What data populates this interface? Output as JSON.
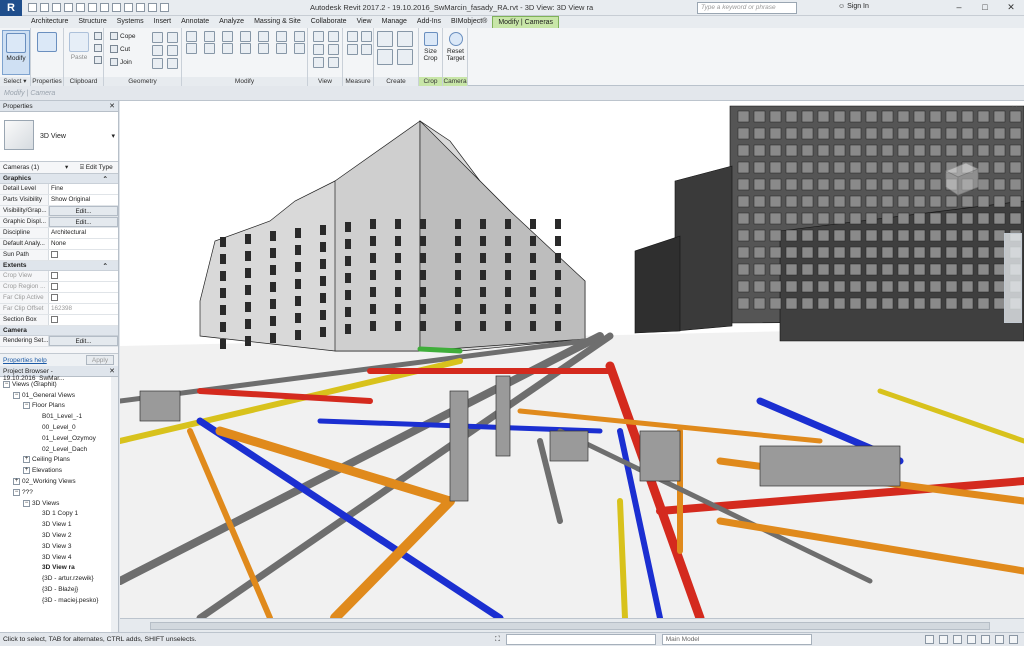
{
  "window": {
    "title": "Autodesk Revit 2017.2 -   19.10.2016_SwMarcin_fasady_RA.rvt - 3D View: 3D View ra",
    "search_placeholder": "Type a keyword or phrase",
    "signin_label": "Sign In",
    "minimize": "–",
    "maximize": "□",
    "close": "✕"
  },
  "ribbon": {
    "tabs": [
      "Architecture",
      "Structure",
      "Systems",
      "Insert",
      "Annotate",
      "Analyze",
      "Massing & Site",
      "Collaborate",
      "View",
      "Manage",
      "Add-Ins",
      "BIMobject®",
      "Modify | Cameras"
    ],
    "active_tab": "Modify | Cameras",
    "panels": {
      "select": {
        "title": "Select ▾",
        "button": "Modify"
      },
      "properties": {
        "title": "Properties"
      },
      "clipboard": {
        "title": "Clipboard",
        "paste": "Paste"
      },
      "geometry": {
        "title": "Geometry",
        "cope": "Cope",
        "cut": "Cut",
        "join": "Join"
      },
      "modify": {
        "title": "Modify"
      },
      "view": {
        "title": "View"
      },
      "measure": {
        "title": "Measure"
      },
      "create": {
        "title": "Create"
      },
      "crop": {
        "title": "Crop",
        "size_crop": "Size Crop"
      },
      "camera": {
        "title": "Camera",
        "reset_target": "Reset Target"
      }
    }
  },
  "options_bar": {
    "text": "Modify | Camera"
  },
  "properties": {
    "header": "Properties",
    "type_name": "3D View",
    "instance_selector": "Cameras (1)",
    "edit_type": "Edit Type",
    "groups": {
      "graphics": "Graphics",
      "extents": "Extents",
      "camera": "Camera"
    },
    "rows": [
      {
        "key": "Detail Level",
        "value": "Fine"
      },
      {
        "key": "Parts Visibility",
        "value": "Show Original"
      },
      {
        "key": "Visibility/Grap...",
        "value": "Edit..."
      },
      {
        "key": "Graphic Displ...",
        "value": "Edit..."
      },
      {
        "key": "Discipline",
        "value": "Architectural"
      },
      {
        "key": "Default Analy...",
        "value": "None"
      },
      {
        "key": "Sun Path",
        "value": ""
      }
    ],
    "extent_rows": [
      {
        "key": "Crop View",
        "value": ""
      },
      {
        "key": "Crop Region ...",
        "value": ""
      },
      {
        "key": "Far Clip Active",
        "value": ""
      },
      {
        "key": "Far Clip Offset",
        "value": "162398"
      },
      {
        "key": "Section Box",
        "value": ""
      }
    ],
    "camera_rows": [
      {
        "key": "Rendering Set...",
        "value": "Edit..."
      }
    ],
    "help_link": "Properties help",
    "apply": "Apply"
  },
  "browser": {
    "header": "Project Browser - 19.10.2016_SwMar...",
    "nodes": [
      {
        "label": "Views (Graphit)",
        "indent": 0,
        "ex": "−"
      },
      {
        "label": "01_General Views",
        "indent": 1,
        "ex": "−"
      },
      {
        "label": "Floor Plans",
        "indent": 2,
        "ex": "−"
      },
      {
        "label": "B01_Level_-1",
        "indent": 3,
        "ex": ""
      },
      {
        "label": "00_Level_0",
        "indent": 3,
        "ex": ""
      },
      {
        "label": "01_Level_Ozymoy",
        "indent": 3,
        "ex": ""
      },
      {
        "label": "02_Level_Dach",
        "indent": 3,
        "ex": ""
      },
      {
        "label": "Ceiling Plans",
        "indent": 2,
        "ex": "+"
      },
      {
        "label": "Elevations",
        "indent": 2,
        "ex": "+"
      },
      {
        "label": "02_Working Views",
        "indent": 1,
        "ex": "+"
      },
      {
        "label": "???",
        "indent": 1,
        "ex": "−"
      },
      {
        "label": "3D Views",
        "indent": 2,
        "ex": "−"
      },
      {
        "label": "3D 1 Copy 1",
        "indent": 3,
        "ex": ""
      },
      {
        "label": "3D View 1",
        "indent": 3,
        "ex": ""
      },
      {
        "label": "3D View 2",
        "indent": 3,
        "ex": ""
      },
      {
        "label": "3D View 3",
        "indent": 3,
        "ex": ""
      },
      {
        "label": "3D View 4",
        "indent": 3,
        "ex": ""
      },
      {
        "label": "3D View ra",
        "indent": 3,
        "ex": "",
        "bold": true
      },
      {
        "label": "{3D - artur.rzewik}",
        "indent": 3,
        "ex": ""
      },
      {
        "label": "{3D - Błażej}",
        "indent": 3,
        "ex": ""
      },
      {
        "label": "{3D - maciej.pesko}",
        "indent": 3,
        "ex": ""
      }
    ]
  },
  "status": {
    "hint": "Click to select, TAB for alternates, CTRL adds, SHIFT unselects.",
    "workset_value": "",
    "model_value": "Main Model"
  },
  "colors": {
    "pipe_red": "#d42a1e",
    "pipe_blue": "#1b2fd1",
    "pipe_orange": "#e08a1c",
    "pipe_yellow": "#d8c21c",
    "pipe_green": "#3fae3a",
    "pipe_gray": "#6e6e6e",
    "context_tab": "#c8e6a8"
  }
}
